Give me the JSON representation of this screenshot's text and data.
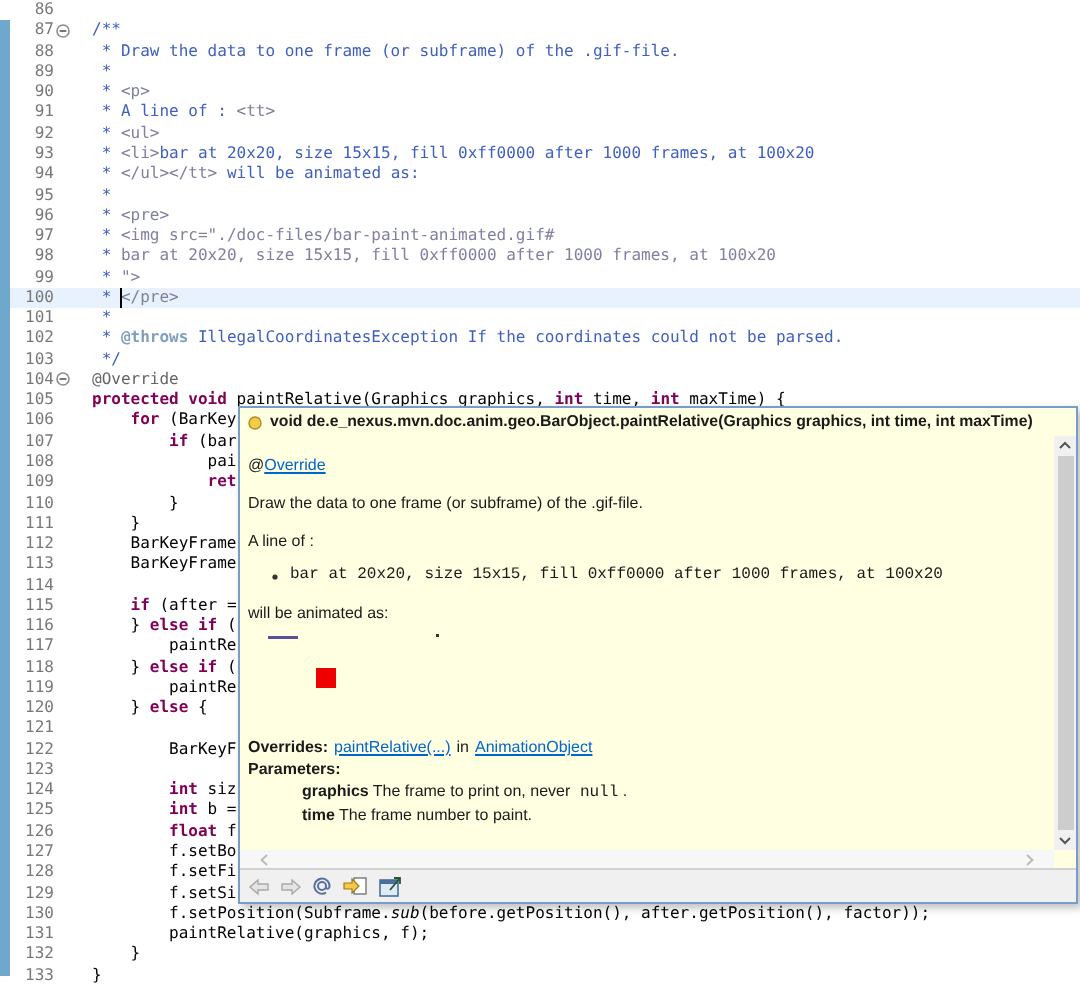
{
  "editor": {
    "lines": [
      {
        "n": "86",
        "kind": "plain"
      },
      {
        "n": "87",
        "kind": "fold",
        "seg": [
          {
            "t": "/**",
            "kind": "doc"
          }
        ]
      },
      {
        "n": "88",
        "kind": "plain",
        "seg": [
          {
            "t": " * Draw the data to one frame (or subframe) of the .gif-file.",
            "kind": "doc"
          }
        ]
      },
      {
        "n": "89",
        "kind": "plain",
        "seg": [
          {
            "t": " *",
            "kind": "doc"
          }
        ]
      },
      {
        "n": "90",
        "kind": "plain",
        "seg": [
          {
            "t": " *",
            "kind": "doc"
          },
          {
            "t": " <p>",
            "kind": "tag"
          }
        ]
      },
      {
        "n": "91",
        "kind": "plain",
        "seg": [
          {
            "t": " * A line of :",
            "kind": "doc"
          },
          {
            "t": " <tt>",
            "kind": "tag"
          }
        ]
      },
      {
        "n": "92",
        "kind": "plain",
        "seg": [
          {
            "t": " *",
            "kind": "doc"
          },
          {
            "t": " <ul>",
            "kind": "tag"
          }
        ]
      },
      {
        "n": "93",
        "kind": "plain",
        "seg": [
          {
            "t": " *",
            "kind": "doc"
          },
          {
            "t": " <li>",
            "kind": "tag"
          },
          {
            "t": "bar at 20x20, size 15x15, fill 0xff0000 after 1000 frames, at 100x20",
            "kind": "doc"
          }
        ]
      },
      {
        "n": "94",
        "kind": "plain",
        "seg": [
          {
            "t": " *",
            "kind": "doc"
          },
          {
            "t": " </ul></tt>",
            "kind": "tag"
          },
          {
            "t": " will be animated as:",
            "kind": "doc"
          }
        ]
      },
      {
        "n": "95",
        "kind": "plain",
        "seg": [
          {
            "t": " *",
            "kind": "doc"
          }
        ]
      },
      {
        "n": "96",
        "kind": "plain",
        "seg": [
          {
            "t": " *",
            "kind": "doc"
          },
          {
            "t": " <pre>",
            "kind": "tag"
          }
        ]
      },
      {
        "n": "97",
        "kind": "plain",
        "seg": [
          {
            "t": " *",
            "kind": "doc"
          },
          {
            "t": " <img src=\"./doc-files/bar-paint-animated.gif#",
            "kind": "tag"
          }
        ]
      },
      {
        "n": "98",
        "kind": "plain",
        "seg": [
          {
            "t": " *",
            "kind": "doc"
          },
          {
            "t": " bar at 20x20, size 15x15, fill 0xff0000 after 1000 frames, at 100x20",
            "kind": "tag"
          }
        ]
      },
      {
        "n": "99",
        "kind": "plain",
        "seg": [
          {
            "t": " *",
            "kind": "doc"
          },
          {
            "t": " \">",
            "kind": "tag"
          }
        ]
      },
      {
        "n": "100",
        "kind": "current",
        "seg": [
          {
            "t": " *",
            "kind": "doc"
          },
          {
            "t": " </pre>",
            "kind": "tag"
          }
        ]
      },
      {
        "n": "101",
        "kind": "plain",
        "seg": [
          {
            "t": " *",
            "kind": "doc"
          }
        ]
      },
      {
        "n": "102",
        "kind": "plain",
        "seg": [
          {
            "t": " *",
            "kind": "doc"
          },
          {
            "t": " @throws",
            "kind": "doctag"
          },
          {
            "t": " IllegalCoordinatesException If the coordinates could not be parsed.",
            "kind": "doc"
          }
        ]
      },
      {
        "n": "103",
        "kind": "plain",
        "seg": [
          {
            "t": " */",
            "kind": "doc"
          }
        ]
      },
      {
        "n": "104",
        "kind": "fold",
        "seg": [
          {
            "t": "@Override",
            "kind": "ann"
          }
        ]
      },
      {
        "n": "105",
        "kind": "plain",
        "seg": [
          {
            "t": "protected void",
            "kind": "kw"
          },
          {
            "t": " paintRelative(Graphics graphics,",
            "kind": "p"
          },
          {
            "t": " int",
            "kind": "kw"
          },
          {
            "t": " time,",
            "kind": "p"
          },
          {
            "t": " int",
            "kind": "kw"
          },
          {
            "t": " maxTime) {",
            "kind": "p"
          }
        ]
      },
      {
        "n": "106",
        "kind": "plain",
        "seg": [
          {
            "t": "    for",
            "kind": "kw"
          },
          {
            "t": " (BarKey",
            "kind": "p"
          }
        ]
      },
      {
        "n": "107",
        "kind": "plain",
        "seg": [
          {
            "t": "        if",
            "kind": "kw"
          },
          {
            "t": " (bar",
            "kind": "p"
          }
        ]
      },
      {
        "n": "108",
        "kind": "plain",
        "seg": [
          {
            "t": "            pai",
            "kind": "p"
          }
        ]
      },
      {
        "n": "109",
        "kind": "plain",
        "seg": [
          {
            "t": "            ret",
            "kind": "kw"
          }
        ]
      },
      {
        "n": "110",
        "kind": "plain",
        "seg": [
          {
            "t": "        }",
            "kind": "p"
          }
        ]
      },
      {
        "n": "111",
        "kind": "plain",
        "seg": [
          {
            "t": "    }",
            "kind": "p"
          }
        ]
      },
      {
        "n": "112",
        "kind": "plain",
        "seg": [
          {
            "t": "    BarKeyFrame",
            "kind": "p"
          }
        ]
      },
      {
        "n": "113",
        "kind": "plain",
        "seg": [
          {
            "t": "    BarKeyFrame",
            "kind": "p"
          }
        ]
      },
      {
        "n": "114",
        "kind": "plain"
      },
      {
        "n": "115",
        "kind": "plain",
        "seg": [
          {
            "t": "    if",
            "kind": "kw"
          },
          {
            "t": " (after =",
            "kind": "p"
          }
        ]
      },
      {
        "n": "116",
        "kind": "plain",
        "seg": [
          {
            "t": "    }",
            "kind": "p"
          },
          {
            "t": " else if",
            "kind": "kw"
          },
          {
            "t": " (",
            "kind": "p"
          }
        ]
      },
      {
        "n": "117",
        "kind": "plain",
        "seg": [
          {
            "t": "        paintRe",
            "kind": "p"
          }
        ]
      },
      {
        "n": "118",
        "kind": "plain",
        "seg": [
          {
            "t": "    }",
            "kind": "p"
          },
          {
            "t": " else if",
            "kind": "kw"
          },
          {
            "t": " (",
            "kind": "p"
          }
        ]
      },
      {
        "n": "119",
        "kind": "plain",
        "seg": [
          {
            "t": "        paintRe",
            "kind": "p"
          }
        ]
      },
      {
        "n": "120",
        "kind": "plain",
        "seg": [
          {
            "t": "    }",
            "kind": "p"
          },
          {
            "t": " else",
            "kind": "kw"
          },
          {
            "t": " {",
            "kind": "p"
          }
        ]
      },
      {
        "n": "121",
        "kind": "plain"
      },
      {
        "n": "122",
        "kind": "plain",
        "seg": [
          {
            "t": "        BarKeyF",
            "kind": "p"
          }
        ]
      },
      {
        "n": "123",
        "kind": "plain"
      },
      {
        "n": "124",
        "kind": "plain",
        "seg": [
          {
            "t": "        int",
            "kind": "kw"
          },
          {
            "t": " siz",
            "kind": "p"
          }
        ]
      },
      {
        "n": "125",
        "kind": "plain",
        "seg": [
          {
            "t": "        int",
            "kind": "kw"
          },
          {
            "t": " b =",
            "kind": "p"
          }
        ]
      },
      {
        "n": "126",
        "kind": "plain",
        "seg": [
          {
            "t": "        float",
            "kind": "kw"
          },
          {
            "t": " f",
            "kind": "p"
          }
        ]
      },
      {
        "n": "127",
        "kind": "plain",
        "seg": [
          {
            "t": "        f.setBo",
            "kind": "p"
          }
        ]
      },
      {
        "n": "128",
        "kind": "plain",
        "seg": [
          {
            "t": "        f.setFi",
            "kind": "p"
          }
        ]
      },
      {
        "n": "129",
        "kind": "plain",
        "seg": [
          {
            "t": "        f.setSi",
            "kind": "p"
          }
        ]
      },
      {
        "n": "130",
        "kind": "plain",
        "seg": [
          {
            "t": "        f.setPosition(Subframe.",
            "kind": "p"
          },
          {
            "t": "sub",
            "kind": "static"
          },
          {
            "t": "(before.getPosition(), after.getPosition(), factor));",
            "kind": "p"
          }
        ]
      },
      {
        "n": "131",
        "kind": "plain",
        "seg": [
          {
            "t": "        paintRelative(graphics, f);",
            "kind": "p"
          }
        ]
      },
      {
        "n": "132",
        "kind": "plain",
        "seg": [
          {
            "t": "    }",
            "kind": "p"
          }
        ]
      },
      {
        "n": "133",
        "kind": "plain",
        "seg": [
          {
            "t": "}",
            "kind": "p"
          }
        ]
      }
    ]
  },
  "hover": {
    "signature": "void de.e_nexus.mvn.doc.anim.geo.BarObject.paintRelative(Graphics graphics, int time, int maxTime)",
    "annotation_prefix": "@",
    "annotation_link": "Override",
    "summary": "Draw the data to one frame (or subframe) of the .gif-file.",
    "line_of": "A line of :",
    "bullets": [
      "bar at 20x20, size 15x15, fill 0xff0000 after 1000 frames, at 100x20"
    ],
    "animated": "will be animated as:",
    "overrides_label": "Overrides:",
    "overrides_method": "paintRelative(...)",
    "overrides_in": "in",
    "overrides_class": "AnimationObject",
    "parameters_label": "Parameters:",
    "params": [
      {
        "name": "graphics",
        "desc": "The frame to print on, never",
        "code": "null",
        "tail": "."
      },
      {
        "name": "time",
        "desc": "The frame number to paint."
      }
    ]
  }
}
